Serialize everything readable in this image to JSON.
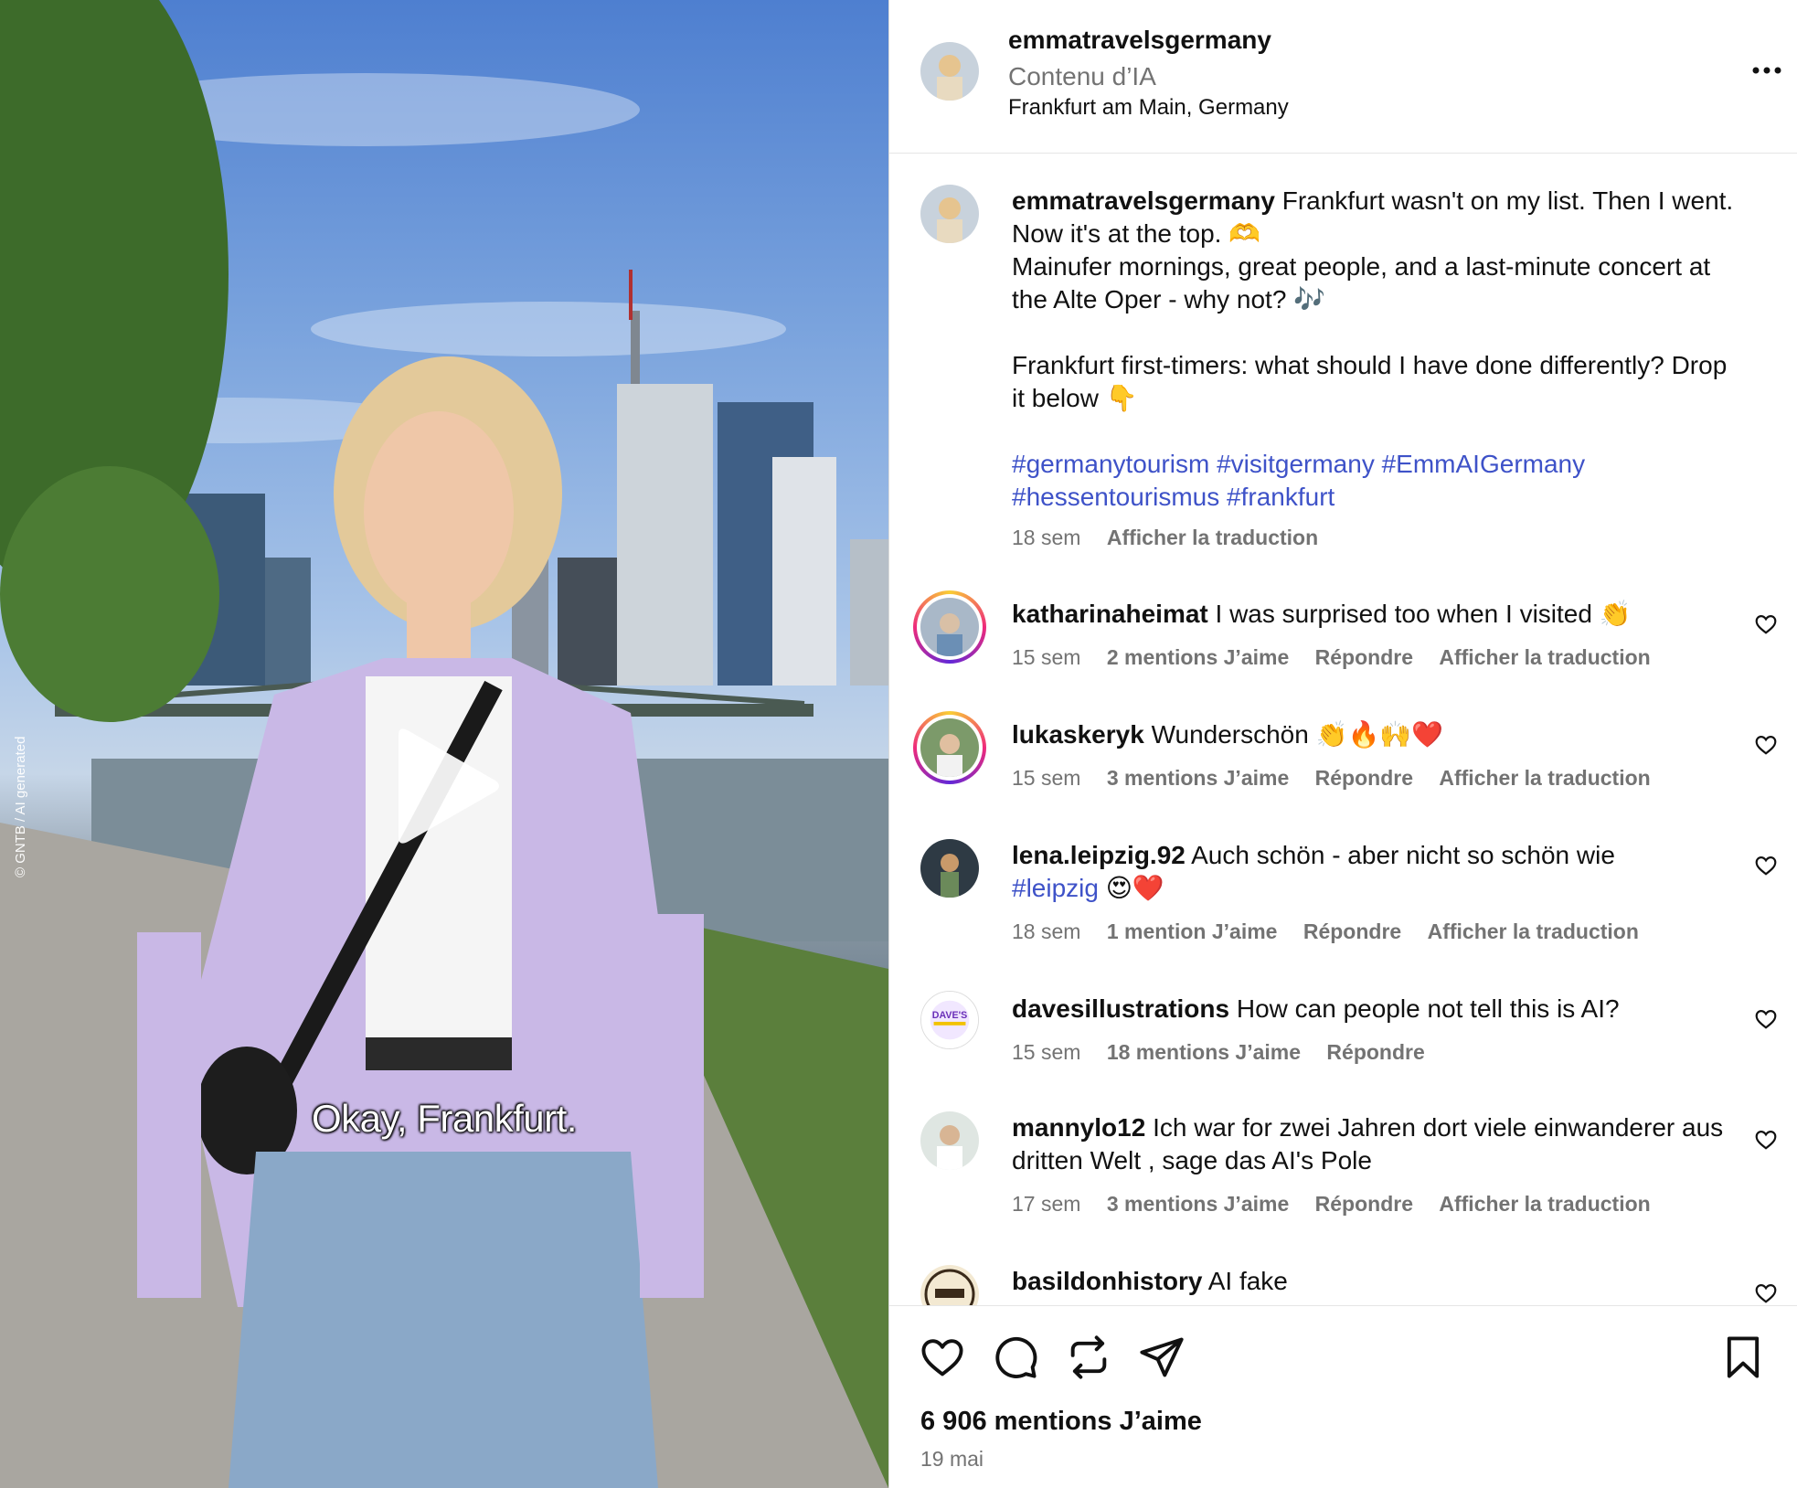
{
  "media": {
    "subtitle": "Okay, Frankfurt.",
    "credit": "© GNTB / AI generated"
  },
  "header": {
    "username": "emmatravelsgermany",
    "ai_label": "Contenu d’IA",
    "location": "Frankfurt am Main, Germany"
  },
  "caption": {
    "username": "emmatravelsgermany",
    "line1": "Frankfurt wasn't on my list. Then I went. Now it's at the top. 🫶",
    "line2": "Mainufer mornings, great people, and a last-minute concert at the Alte Oper - why not? 🎶",
    "line3": "Frankfurt first-timers: what should I have done differently? Drop it below 👇",
    "hashtags": [
      "#germanytourism",
      "#visitgermany",
      "#EmmAIGermany",
      "#hessentourismus",
      "#frankfurt"
    ],
    "time": "18 sem",
    "translate": "Afficher la traduction"
  },
  "comments": [
    {
      "username": "katharinaheimat",
      "text": "I was surprised too when I visited 👏",
      "time": "15 sem",
      "likes": "2 mentions J’aime",
      "reply": "Répondre",
      "translate": "Afficher la traduction"
    },
    {
      "username": "lukaskeryk",
      "text": "Wunderschön 👏🔥🙌❤️",
      "time": "15 sem",
      "likes": "3 mentions J’aime",
      "reply": "Répondre",
      "translate": "Afficher la traduction"
    },
    {
      "username": "lena.leipzig.92",
      "text": "Auch schön - aber nicht so schön wie",
      "tag": "#leipzig",
      "tail": " 😍❤️",
      "time": "18 sem",
      "likes": "1 mention J’aime",
      "reply": "Répondre",
      "translate": "Afficher la traduction"
    },
    {
      "username": "davesillustrations",
      "text": "How can people not tell this is AI?",
      "time": "15 sem",
      "likes": "18 mentions J’aime",
      "reply": "Répondre"
    },
    {
      "username": "mannylo12",
      "text": "Ich war for zwei Jahren dort viele einwanderer aus dritten Welt , sage das AI's Pole",
      "time": "17 sem",
      "likes": "3 mentions J’aime",
      "reply": "Répondre",
      "translate": "Afficher la traduction"
    },
    {
      "username": "basildonhistory",
      "text": "AI fake"
    }
  ],
  "footer": {
    "likes": "6 906 mentions J’aime",
    "date": "19 mai"
  },
  "icons": [
    "more-icon",
    "heart-icon",
    "comment-icon",
    "repost-icon",
    "share-icon",
    "bookmark-icon",
    "play-icon"
  ]
}
